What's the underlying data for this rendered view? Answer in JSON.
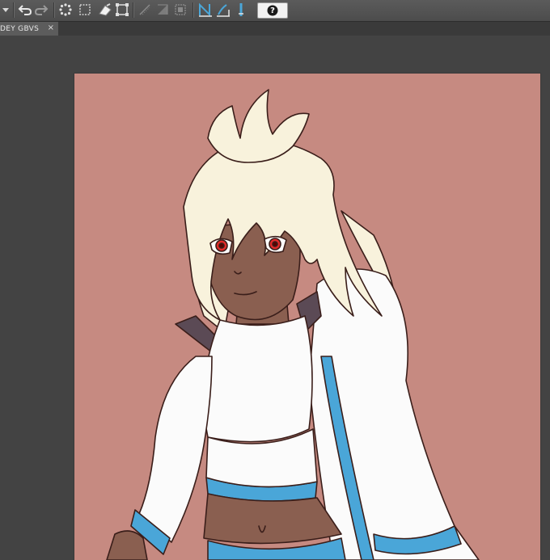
{
  "toolbar": {
    "help_label": "?",
    "icons": [
      "dropdown-arrow-icon",
      "undo-icon",
      "redo-icon",
      "select-all-icon",
      "deselect-icon",
      "clear-icon",
      "transform-icon",
      "snap-ruler-icon",
      "snap-grid-icon",
      "snap-special-icon",
      "pen-pressure-icon",
      "stroke-correction-icon",
      "pin-icon"
    ]
  },
  "tabs": [
    {
      "label": "DEY GBVS",
      "close": "×"
    }
  ],
  "colors": {
    "accent": "#4aa6d8",
    "canvas_bg": "#c68a81",
    "workspace_bg": "#434343"
  }
}
